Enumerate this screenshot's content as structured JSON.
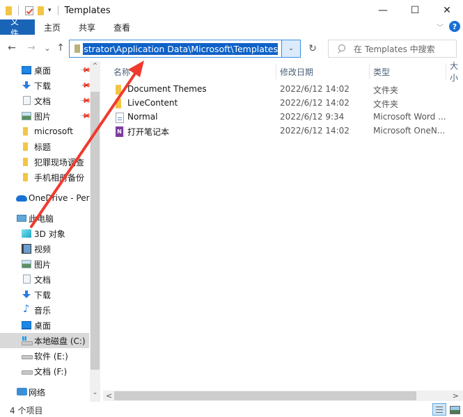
{
  "window": {
    "title": "Templates",
    "controls": {
      "minimize": "—",
      "maximize": "☐",
      "close": "✕"
    }
  },
  "quick_access_toolbar": {
    "dropdown_glyph": "▾"
  },
  "ribbon": {
    "tabs": [
      {
        "label": "文件",
        "active": true
      },
      {
        "label": "主页"
      },
      {
        "label": "共享"
      },
      {
        "label": "查看"
      }
    ],
    "expand_glyph": "﹀",
    "help_glyph": "?"
  },
  "navigation": {
    "back_glyph": "←",
    "forward_glyph": "→",
    "recent_glyph": "⌄",
    "up_glyph": "↑",
    "address_value": "C:\\Users\\Administrator\\Application Data\\Microsoft\\Templates",
    "address_visible": "Administrator\\Application Data\\Microsoft\\Templates",
    "address_dropdown_glyph": "⌄",
    "refresh_glyph": "↻",
    "search_placeholder": "在 Templates 中搜索"
  },
  "sidebar": {
    "quick_access": [
      {
        "label": "桌面",
        "icon": "desktop-icon",
        "pinned": true
      },
      {
        "label": "下载",
        "icon": "download-icon",
        "pinned": true
      },
      {
        "label": "文档",
        "icon": "document-icon",
        "pinned": true
      },
      {
        "label": "图片",
        "icon": "picture-icon",
        "pinned": true
      },
      {
        "label": "microsoft",
        "icon": "folder-icon",
        "pinned": false
      },
      {
        "label": "标题",
        "icon": "folder-icon",
        "pinned": false
      },
      {
        "label": "犯罪现场调查",
        "icon": "folder-icon",
        "pinned": false
      },
      {
        "label": "手机相册备份",
        "icon": "folder-icon",
        "pinned": false
      }
    ],
    "onedrive": {
      "label": "OneDrive - Perso",
      "icon": "onedrive-cloud-icon"
    },
    "this_pc": {
      "label": "此电脑",
      "children": [
        {
          "label": "3D 对象",
          "icon": "3d-objects-icon"
        },
        {
          "label": "视频",
          "icon": "video-icon"
        },
        {
          "label": "图片",
          "icon": "picture-icon"
        },
        {
          "label": "文档",
          "icon": "document-icon"
        },
        {
          "label": "下载",
          "icon": "download-icon"
        },
        {
          "label": "音乐",
          "icon": "music-icon"
        },
        {
          "label": "桌面",
          "icon": "desktop-icon"
        },
        {
          "label": "本地磁盘 (C:)",
          "icon": "system-drive-icon",
          "selected": true
        },
        {
          "label": "软件 (E:)",
          "icon": "drive-icon"
        },
        {
          "label": "文档 (F:)",
          "icon": "drive-icon"
        }
      ]
    },
    "network": {
      "label": "网络",
      "icon": "network-icon"
    },
    "pin_glyph": "📌",
    "scroll_up_glyph": "^",
    "scroll_down_glyph": "⌄"
  },
  "file_list": {
    "sort_glyph": "^",
    "columns": [
      "名称",
      "修改日期",
      "类型",
      "大小"
    ],
    "rows": [
      {
        "name": "Document Themes",
        "date": "2022/6/12 14:02",
        "type": "文件夹",
        "icon": "folder-icon"
      },
      {
        "name": "LiveContent",
        "date": "2022/6/12 14:02",
        "type": "文件夹",
        "icon": "folder-icon"
      },
      {
        "name": "Normal",
        "date": "2022/6/12 9:34",
        "type": "Microsoft Word ...",
        "icon": "word-template-icon"
      },
      {
        "name": "打开笔记本",
        "date": "2022/6/12 14:02",
        "type": "Microsoft OneN...",
        "icon": "onenote-icon"
      }
    ],
    "onenote_glyph": "N"
  },
  "hscroll": {
    "left_glyph": "<",
    "right_glyph": ">"
  },
  "status_bar": {
    "item_count": "4 个项目"
  },
  "annotation": {
    "color": "#f03a2e"
  }
}
